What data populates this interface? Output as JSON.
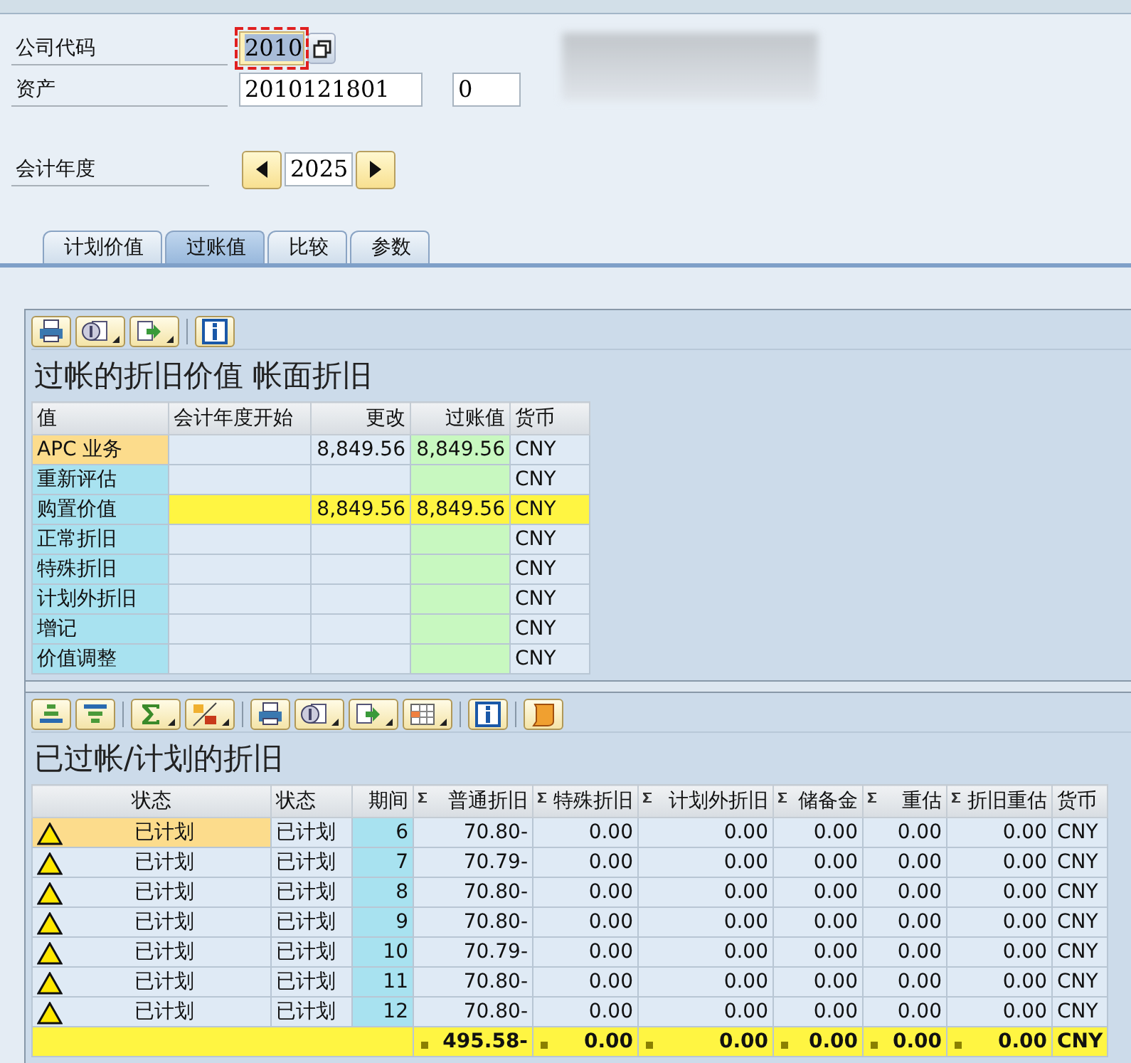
{
  "company_code": {
    "label": "公司代码",
    "value": "2010",
    "focused": true
  },
  "asset": {
    "label": "资产",
    "value": "2010121801",
    "sub_number": "0"
  },
  "fiscal_year": {
    "label": "会计年度",
    "value": "2025"
  },
  "tabs": [
    {
      "label": "计划价值",
      "selected": false
    },
    {
      "label": "过账值",
      "selected": true
    },
    {
      "label": "比较",
      "selected": false
    },
    {
      "label": "参数",
      "selected": false
    }
  ],
  "posted_values": {
    "title": "过帐的折旧价值 帐面折旧",
    "columns": [
      "值",
      "会计年度开始",
      "更改",
      "过账值",
      "货币"
    ],
    "rows": [
      {
        "kind": "item",
        "selected": true,
        "label": "APC 业务",
        "change": "8,849.56",
        "posted": "8,849.56",
        "currency": "CNY"
      },
      {
        "kind": "item",
        "selected": false,
        "label": "重新评估",
        "currency": "CNY"
      },
      {
        "kind": "total",
        "selected": false,
        "label": "购置价值",
        "change": "8,849.56",
        "posted": "8,849.56",
        "currency": "CNY"
      },
      {
        "kind": "item",
        "selected": false,
        "label": "正常折旧",
        "currency": "CNY"
      },
      {
        "kind": "item",
        "selected": false,
        "label": "特殊折旧",
        "currency": "CNY"
      },
      {
        "kind": "item",
        "selected": false,
        "label": "计划外折旧",
        "currency": "CNY"
      },
      {
        "kind": "item",
        "selected": false,
        "label": "增记",
        "currency": "CNY"
      },
      {
        "kind": "item",
        "selected": false,
        "label": "价值调整",
        "currency": "CNY"
      }
    ]
  },
  "depreciation": {
    "title": "已过帐/计划的折旧",
    "columns": [
      {
        "label": "状态",
        "summed": false
      },
      {
        "label": "状态",
        "summed": false
      },
      {
        "label": "期间",
        "summed": false
      },
      {
        "label": "普通折旧",
        "summed": true
      },
      {
        "label": "特殊折旧",
        "summed": true
      },
      {
        "label": "计划外折旧",
        "summed": true
      },
      {
        "label": "储备金",
        "summed": true
      },
      {
        "label": "重估",
        "summed": true
      },
      {
        "label": "折旧重估",
        "summed": true
      },
      {
        "label": "货币",
        "summed": false
      }
    ],
    "rows": [
      {
        "selected": true,
        "kind": "warning",
        "status_text": "已计划",
        "status": "已计划",
        "period": "6",
        "values": [
          "70.80-",
          "0.00",
          "0.00",
          "0.00",
          "0.00",
          "0.00"
        ],
        "currency": "CNY"
      },
      {
        "selected": false,
        "kind": "warning",
        "status_text": "已计划",
        "status": "已计划",
        "period": "7",
        "values": [
          "70.79-",
          "0.00",
          "0.00",
          "0.00",
          "0.00",
          "0.00"
        ],
        "currency": "CNY"
      },
      {
        "selected": false,
        "kind": "warning",
        "status_text": "已计划",
        "status": "已计划",
        "period": "8",
        "values": [
          "70.80-",
          "0.00",
          "0.00",
          "0.00",
          "0.00",
          "0.00"
        ],
        "currency": "CNY"
      },
      {
        "selected": false,
        "kind": "warning",
        "status_text": "已计划",
        "status": "已计划",
        "period": "9",
        "values": [
          "70.80-",
          "0.00",
          "0.00",
          "0.00",
          "0.00",
          "0.00"
        ],
        "currency": "CNY"
      },
      {
        "selected": false,
        "kind": "warning",
        "status_text": "已计划",
        "status": "已计划",
        "period": "10",
        "values": [
          "70.79-",
          "0.00",
          "0.00",
          "0.00",
          "0.00",
          "0.00"
        ],
        "currency": "CNY"
      },
      {
        "selected": false,
        "kind": "warning",
        "status_text": "已计划",
        "status": "已计划",
        "period": "11",
        "values": [
          "70.80-",
          "0.00",
          "0.00",
          "0.00",
          "0.00",
          "0.00"
        ],
        "currency": "CNY"
      },
      {
        "selected": false,
        "kind": "warning",
        "status_text": "已计划",
        "status": "已计划",
        "period": "12",
        "values": [
          "70.80-",
          "0.00",
          "0.00",
          "0.00",
          "0.00",
          "0.00"
        ],
        "currency": "CNY"
      }
    ],
    "total": {
      "values": [
        "495.58-",
        "0.00",
        "0.00",
        "0.00",
        "0.00",
        "0.00"
      ],
      "currency": "CNY"
    }
  }
}
